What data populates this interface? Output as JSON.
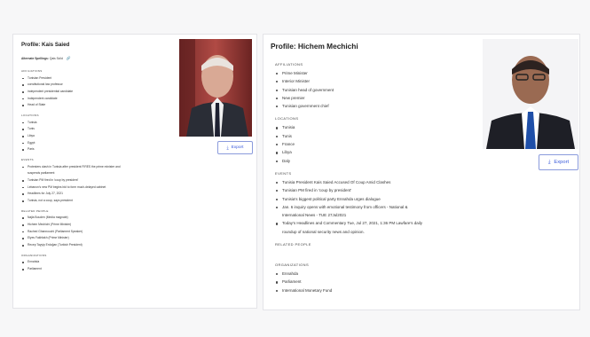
{
  "left_profile": {
    "title": "Profile: Kais Saied",
    "alt_spellings_label": "Alternate Spellings:",
    "alt_spellings_value": "Qais Sa'id",
    "export_label": "Export",
    "sections": [
      {
        "heading": "AFFILIATIONS",
        "items": [
          "Tunisian President",
          "constitutional law professor",
          "independent presidential candidate",
          "Independent candidate",
          "Head of State"
        ]
      },
      {
        "heading": "LOCATIONS",
        "items": [
          "Tunisia",
          "Tunis",
          "Libya",
          "Egypt",
          "Paris"
        ]
      },
      {
        "heading": "EVENTS",
        "items": [
          "Protesters clash in Tunisia after president FIRES the prime minister and",
          "suspends parliament",
          "Tunisian PM fired in 'coup by president'",
          "Lebanon's new PM begins bid to form much-delayed cabinet",
          "Headlines for July 27, 2021",
          "Tunisia, not a coup, says president"
        ]
      },
      {
        "heading": "RELATED PEOPLE",
        "items": [
          "Najla Bouden (Media magnate)",
          "Hichem Mechichi (Prime Minister)",
          "Rached Ghannouchi (Parliament Speaker)",
          "Elyes Fakhfakh (Prime Minister)",
          "Recep Tayyip Erdoğan (Turkish President)"
        ]
      },
      {
        "heading": "ORGANIZATIONS",
        "items": [
          "Ennahda",
          "Parliament"
        ]
      }
    ]
  },
  "right_profile": {
    "title": "Profile: Hichem Mechichi",
    "export_label": "Export",
    "sections": [
      {
        "heading": "AFFILIATIONS",
        "items": [
          "Prime Minister",
          "Interior Minister",
          "Tunisian head of government",
          "New premier",
          "Tunisian government chief"
        ]
      },
      {
        "heading": "LOCATIONS",
        "items": [
          "Tunisia",
          "Tunis",
          "France",
          "Libya",
          "Daly"
        ]
      },
      {
        "heading": "EVENTS",
        "items": [
          "Tunisia President Kais Saied Accused Of Coup Amid Clashes",
          "Tunisian PM fired in 'coup by president'",
          "Tunisia's biggest political party Ennahda urges dialogue",
          "Jan. 6 inquiry opens with emotional testimony from officers - National &",
          "International News - TUE 27Jul2021",
          "Today's Headlines and Commentary Tue, Jul 27, 2021, 1:36 PM Lawfare's daily",
          "roundup of national security news and opinion."
        ]
      },
      {
        "heading": "RELATED PEOPLE",
        "items": []
      },
      {
        "heading": "ORGANIZATIONS",
        "items": [
          "Ennahda",
          "Parliament",
          "International Monetary Fund"
        ]
      }
    ]
  }
}
